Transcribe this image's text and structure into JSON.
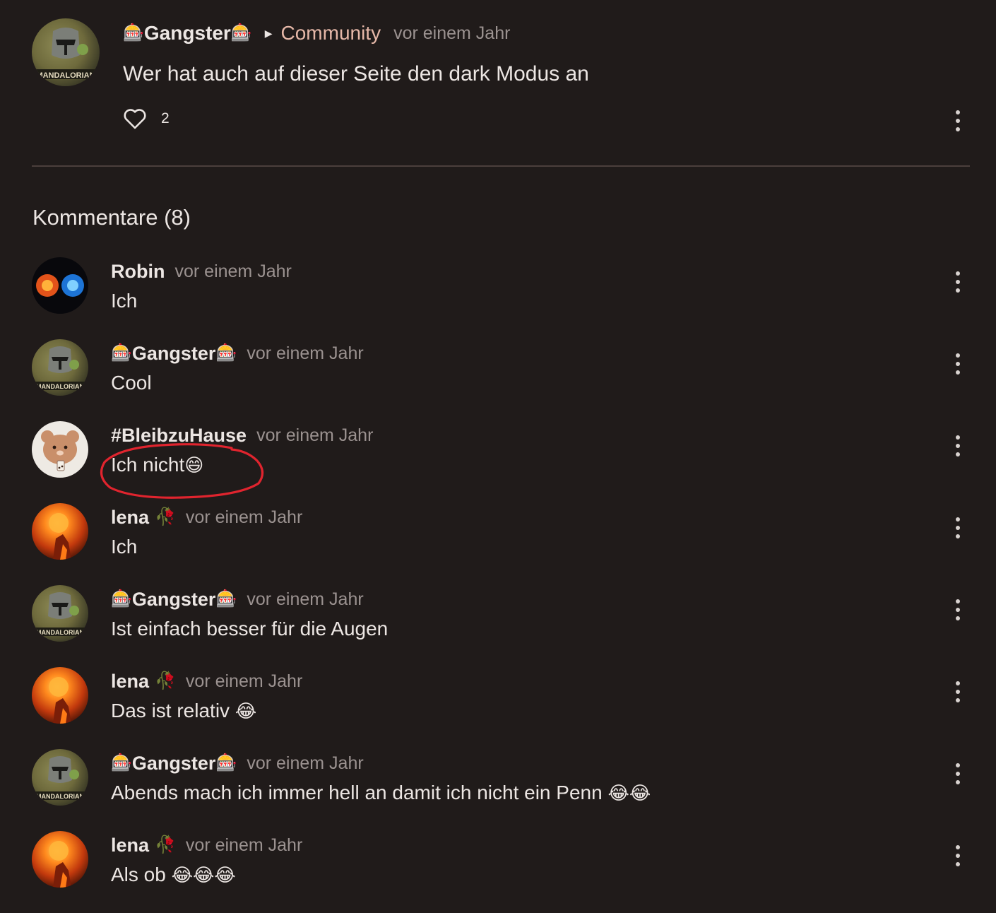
{
  "post": {
    "author": "🎰Gangster🎰",
    "author_name": "Gangster",
    "community": "Community",
    "time": "vor einem Jahr",
    "text": "Wer hat auch auf dieser Seite den dark Modus an",
    "likes": "2"
  },
  "comments_title": "Kommentare (8)",
  "comments": [
    {
      "name": "Robin",
      "time": "vor einem Jahr",
      "text": "Ich"
    },
    {
      "name": "Gangster",
      "time": "vor einem Jahr",
      "text": "Cool"
    },
    {
      "name": "#BleibzuHause",
      "time": "vor einem Jahr",
      "text": "Ich nicht",
      "emoji": "😄"
    },
    {
      "name": "lena",
      "time": "vor einem Jahr",
      "text": "Ich"
    },
    {
      "name": "Gangster",
      "time": "vor einem Jahr",
      "text": "Ist einfach besser für die Augen"
    },
    {
      "name": "lena",
      "time": "vor einem Jahr",
      "text": "Das ist relativ",
      "emoji": "😂"
    },
    {
      "name": "Gangster",
      "time": "vor einem Jahr",
      "text": "Abends mach ich immer hell an damit ich nicht ein Penn",
      "emoji": "😂😂"
    },
    {
      "name": "lena",
      "time": "vor einem Jahr",
      "text": "Als ob",
      "emoji": "😂😂😂"
    }
  ],
  "icons": {
    "slot": "🎰",
    "rose": "🥀",
    "like": "heart-icon",
    "menu": "more-vertical-icon",
    "caret": "caret-right-icon"
  },
  "colors": {
    "background": "#201b1a",
    "community": "#e6b8a8",
    "muted": "#9b9290",
    "annotation": "#e0242e"
  }
}
